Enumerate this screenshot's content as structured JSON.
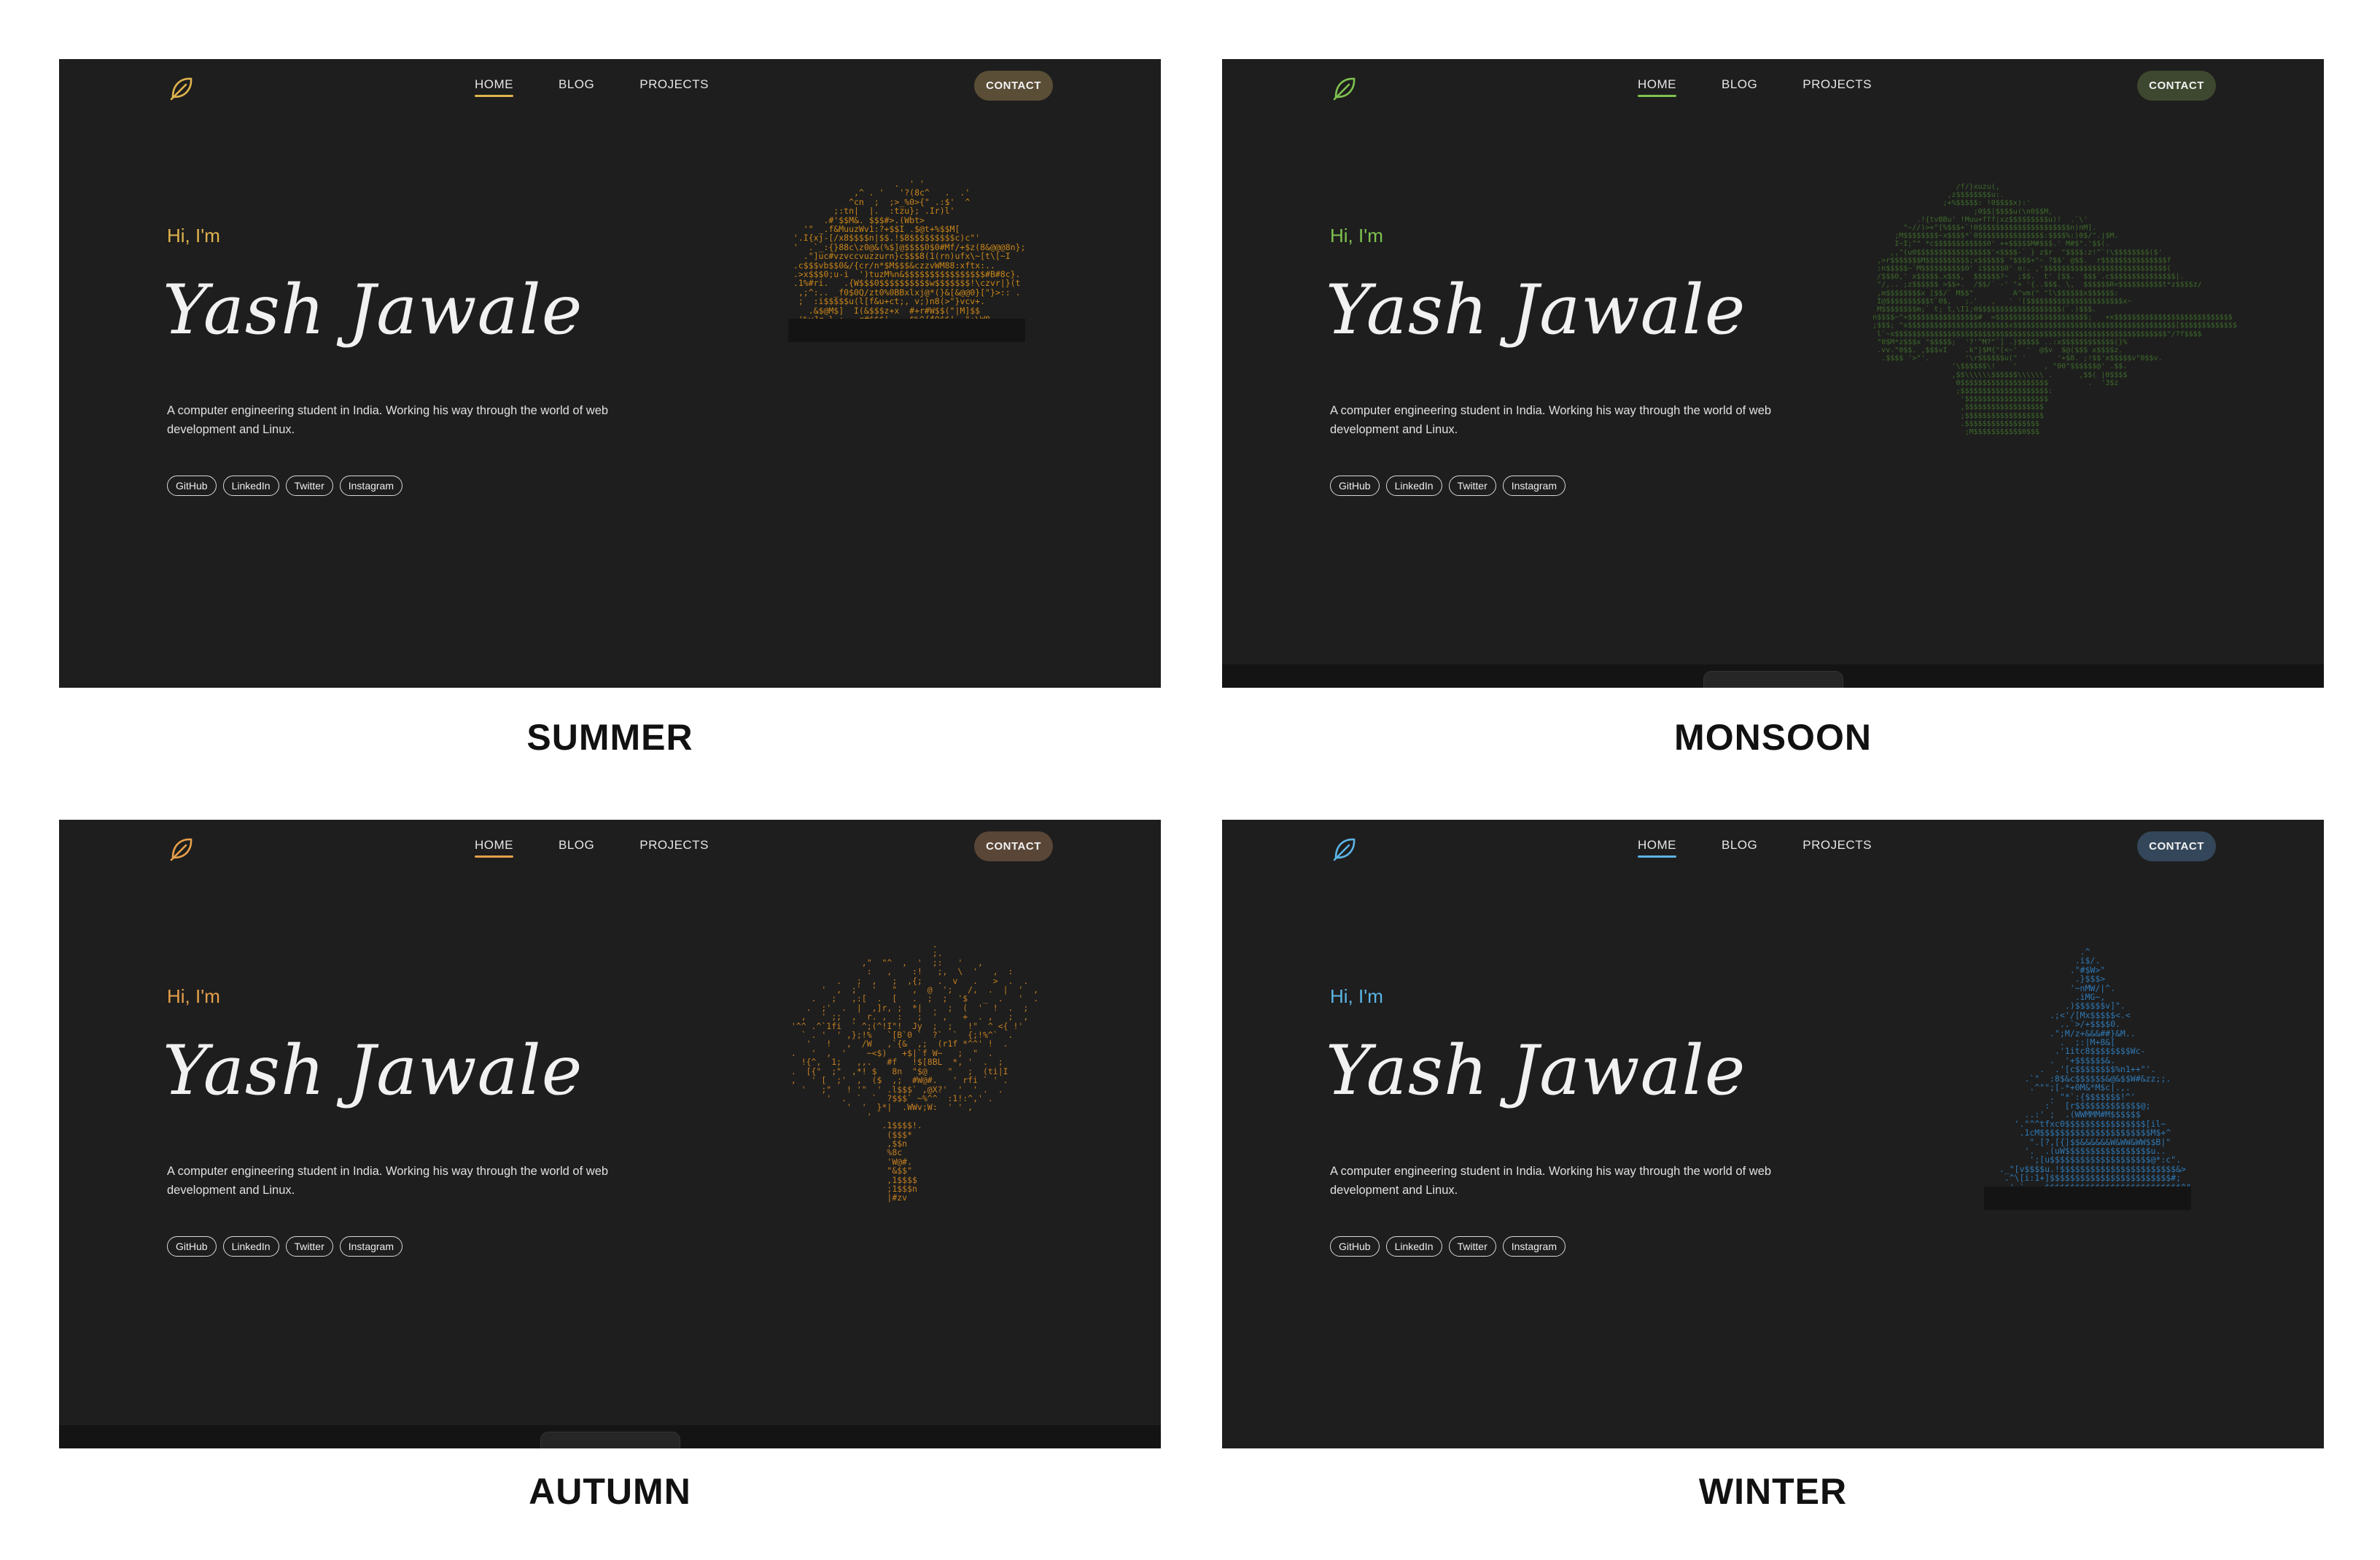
{
  "site": {
    "nav": [
      "HOME",
      "BLOG",
      "PROJECTS"
    ],
    "contact_label": "CONTACT",
    "greeting": "Hi, I'm",
    "name": "Yash Jawale",
    "description": "A computer engineering student in India. Working his way through the world of web development and Linux.",
    "socials": [
      "GitHub",
      "LinkedIn",
      "Twitter",
      "Instagram"
    ],
    "logo_icon": "leaf-icon"
  },
  "themes": [
    {
      "label": "SUMMER",
      "accent": "#e0b44e",
      "button": "#5a4e37",
      "art_color": "#c9861a",
      "art_type": "palm-tree"
    },
    {
      "label": "MONSOON",
      "accent": "#7fc24f",
      "button": "#3e4830",
      "art_color": "#3d6a2a",
      "art_type": "leafy-tree"
    },
    {
      "label": "AUTUMN",
      "accent": "#e6a04a",
      "button": "#5a4637",
      "art_color": "#c47f22",
      "art_type": "bare-tree"
    },
    {
      "label": "WINTER",
      "accent": "#5bb4e6",
      "button": "#34475a",
      "art_color": "#2f79b5",
      "art_type": "pine-tree"
    }
  ]
}
